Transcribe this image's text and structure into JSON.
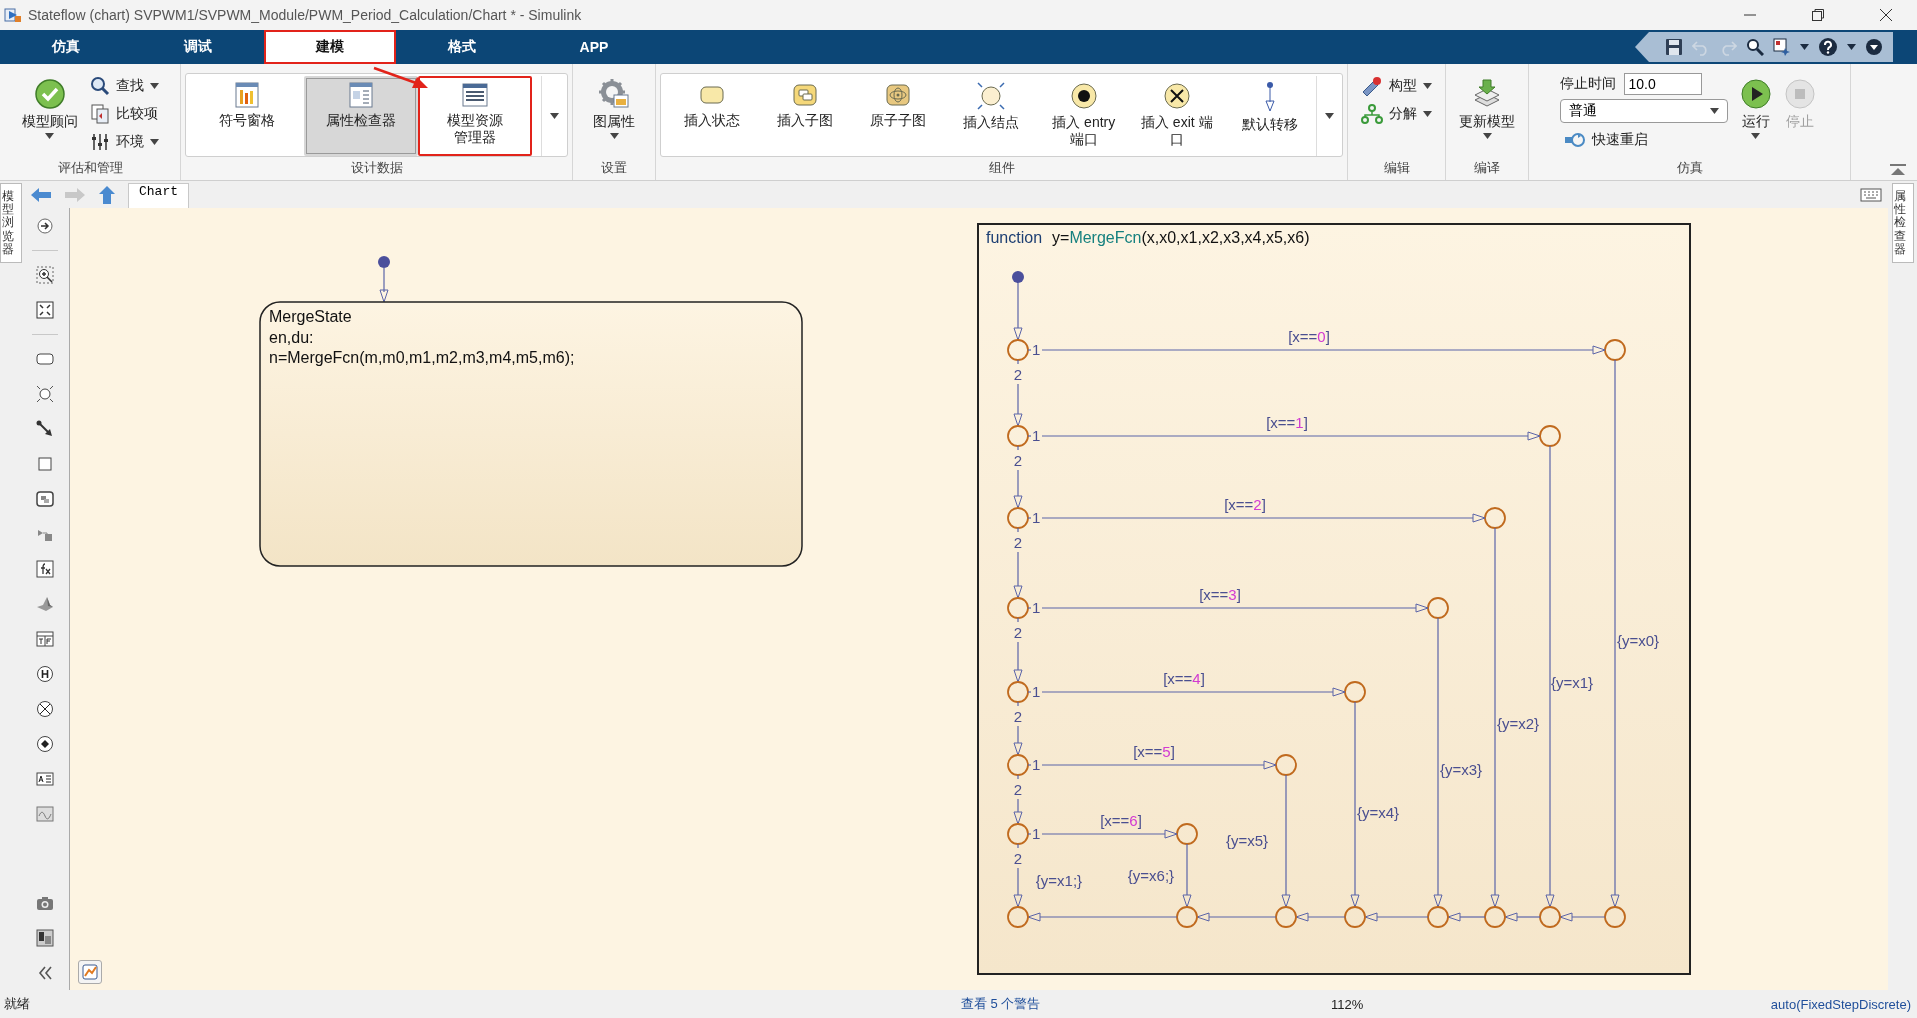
{
  "window": {
    "title": "Stateflow (chart) SVPWM1/SVPWM_Module/PWM_Period_Calculation/Chart * - Simulink"
  },
  "tabs": [
    {
      "label": "仿真",
      "selected": false,
      "highlighted": false
    },
    {
      "label": "调试",
      "selected": false,
      "highlighted": false
    },
    {
      "label": "建模",
      "selected": true,
      "highlighted": true
    },
    {
      "label": "格式",
      "selected": false,
      "highlighted": false
    },
    {
      "label": "APP",
      "selected": false,
      "highlighted": false
    }
  ],
  "quick_access": {
    "undo_disabled": true,
    "redo_disabled": true
  },
  "ribbon": {
    "groups": [
      {
        "title": "评估和管理",
        "gallery": false,
        "items": [
          {
            "kind": "large",
            "lines": [
              "模型顾问"
            ],
            "menu": true
          },
          {
            "kind": "stack",
            "items": [
              {
                "label": "查找",
                "menu": true
              },
              {
                "label": "比较项",
                "menu": false
              },
              {
                "label": "环境",
                "menu": true
              }
            ]
          }
        ]
      },
      {
        "title": "设计数据",
        "gallery": true,
        "items": [
          {
            "kind": "large",
            "lines": [
              "符号窗格"
            ],
            "selected": false,
            "highlighted": false
          },
          {
            "kind": "large",
            "lines": [
              "属性检查器"
            ],
            "selected": true,
            "highlighted": false
          },
          {
            "kind": "large",
            "lines": [
              "模型资源",
              "管理器"
            ],
            "selected": false,
            "highlighted": true
          }
        ]
      },
      {
        "title": "设置",
        "gallery": false,
        "items": [
          {
            "kind": "large",
            "lines": [
              "图属性"
            ],
            "menu": true
          }
        ]
      },
      {
        "title": "组件",
        "gallery": true,
        "items": [
          {
            "kind": "large",
            "lines": [
              "插入状态"
            ]
          },
          {
            "kind": "large",
            "lines": [
              "插入子图"
            ]
          },
          {
            "kind": "large",
            "lines": [
              "原子子图"
            ]
          },
          {
            "kind": "large",
            "lines": [
              "插入结点"
            ]
          },
          {
            "kind": "large",
            "lines": [
              "插入 entry",
              "端口"
            ]
          },
          {
            "kind": "large",
            "lines": [
              "插入 exit 端",
              "口"
            ]
          },
          {
            "kind": "large",
            "lines": [
              "默认转移"
            ]
          }
        ]
      },
      {
        "title": "编辑",
        "gallery": false,
        "items": [
          {
            "kind": "stack",
            "items": [
              {
                "label": "构型",
                "menu": true
              },
              {
                "label": "分解",
                "menu": true
              }
            ]
          }
        ]
      },
      {
        "title": "编译",
        "gallery": false,
        "items": [
          {
            "kind": "large",
            "lines": [
              "更新模型"
            ],
            "menu": true
          }
        ]
      },
      {
        "title": "仿真",
        "gallery": false,
        "items": [
          {
            "kind": "sim",
            "stop_time_label": "停止时间",
            "stop_time": "10.0",
            "mode": "普通",
            "fast_restart": "快速重启"
          },
          {
            "kind": "large",
            "lines": [
              "运行"
            ],
            "menu": true,
            "disabled": false
          },
          {
            "kind": "large",
            "lines": [
              "停止"
            ],
            "menu": false,
            "disabled": true
          }
        ]
      }
    ]
  },
  "side_tabs": {
    "left": "模型浏览器",
    "right": "属性检查器"
  },
  "nav": {
    "back_disabled": false,
    "forward_disabled": true,
    "up_disabled": false,
    "breadcrumb": "Chart"
  },
  "chart": {
    "state": {
      "name": "MergeState",
      "lines": [
        "en,du:",
        "n=MergeFcn(m,m0,m1,m2,m3,m4,m5,m6);"
      ]
    },
    "graphical_function": {
      "keyword": "function",
      "output": "y=",
      "name": "MergeFcn",
      "args": "(x,x0,x1,x2,x3,x4,x5,x6)",
      "branches": [
        {
          "guard_open": "[x==",
          "guard_value": "0",
          "guard_close": "]",
          "true_priority": "1",
          "false_priority": "2",
          "action": "{y=x0}"
        },
        {
          "guard_open": "[x==",
          "guard_value": "1",
          "guard_close": "]",
          "true_priority": "1",
          "false_priority": "2",
          "action": "{y=x1}"
        },
        {
          "guard_open": "[x==",
          "guard_value": "2",
          "guard_close": "]",
          "true_priority": "1",
          "false_priority": "2",
          "action": "{y=x2}"
        },
        {
          "guard_open": "[x==",
          "guard_value": "3",
          "guard_close": "]",
          "true_priority": "1",
          "false_priority": "2",
          "action": "{y=x3}"
        },
        {
          "guard_open": "[x==",
          "guard_value": "4",
          "guard_close": "]",
          "true_priority": "1",
          "false_priority": "2",
          "action": "{y=x4}"
        },
        {
          "guard_open": "[x==",
          "guard_value": "5",
          "guard_close": "]",
          "true_priority": "1",
          "false_priority": "2",
          "action": "{y=x5}"
        },
        {
          "guard_open": "[x==",
          "guard_value": "6",
          "guard_close": "]",
          "true_priority": "1",
          "false_priority": "2",
          "action": "{y=x6;}"
        }
      ],
      "fallback_action": "{y=x1;}"
    }
  },
  "status_bar": {
    "message": "就绪",
    "warnings_link": "查看 5 个警告",
    "zoom": "112%",
    "solver": "auto(FixedStepDiscrete)"
  }
}
